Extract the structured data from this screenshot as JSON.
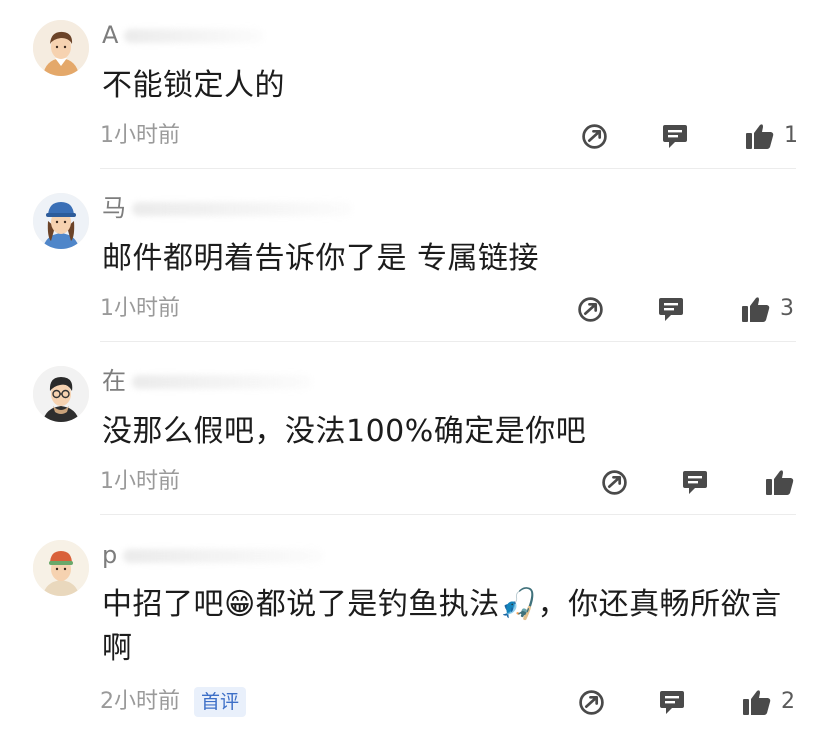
{
  "comments": [
    {
      "username": "A",
      "text": "不能锁定人的",
      "time": "1小时前",
      "badge": "",
      "likes": "1"
    },
    {
      "username": "马",
      "text": "邮件都明着告诉你了是 专属链接",
      "time": "1小时前",
      "badge": "",
      "likes": "3"
    },
    {
      "username": "在",
      "text": "没那么假吧，没法100%确定是你吧",
      "time": "1小时前",
      "badge": "",
      "likes": ""
    },
    {
      "username": "p",
      "text": "中招了吧😁都说了是钓鱼执法🎣，你还真畅所欲言啊",
      "time": "2小时前",
      "badge": "首评",
      "likes": "2"
    }
  ],
  "icons": {
    "share": "share-icon",
    "reply": "comment-icon",
    "like": "thumbs-up-icon"
  },
  "colors": {
    "icon": "#4a4a4a",
    "badge_bg": "#e9f0fb",
    "badge_text": "#3d6fc7",
    "meta": "#9a9a9a"
  }
}
